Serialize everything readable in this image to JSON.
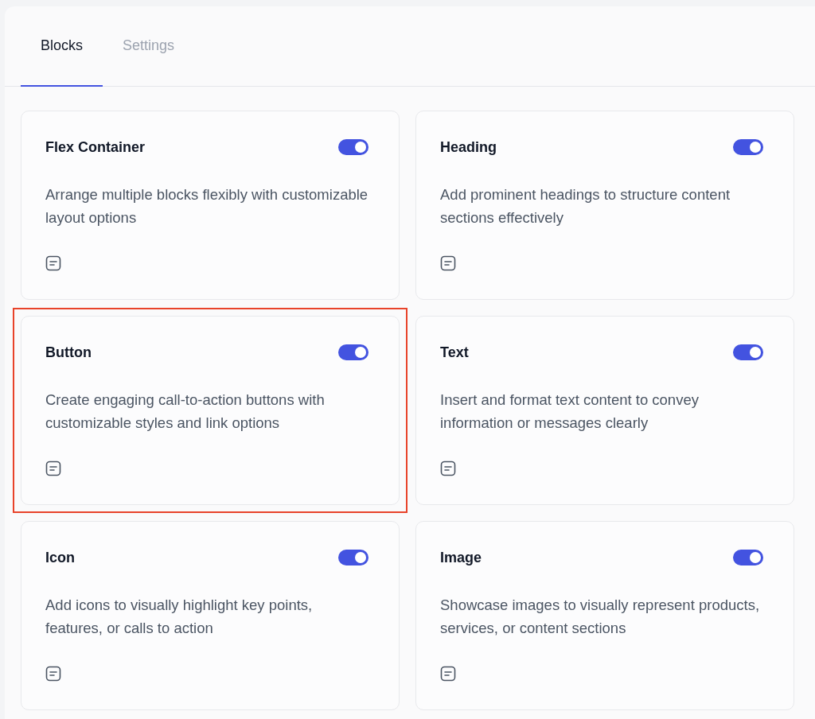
{
  "tabs": [
    {
      "label": "Blocks",
      "selected": true
    },
    {
      "label": "Settings",
      "selected": false
    }
  ],
  "blocks": [
    {
      "title": "Flex Container",
      "description": "Arrange multiple blocks flexibly with customizable layout options",
      "on": true,
      "highlighted": false
    },
    {
      "title": "Heading",
      "description": "Add prominent headings to structure content sections effectively",
      "on": true,
      "highlighted": false
    },
    {
      "title": "Button",
      "description": "Create engaging call-to-action buttons with customizable styles and link options",
      "on": true,
      "highlighted": true
    },
    {
      "title": "Text",
      "description": "Insert and format text content to convey information or messages clearly",
      "on": true,
      "highlighted": false
    },
    {
      "title": "Icon",
      "description": "Add icons to visually highlight key points, features, or calls to action",
      "on": true,
      "highlighted": false
    },
    {
      "title": "Image",
      "description": "Showcase images to visually represent products, services, or content sections",
      "on": true,
      "highlighted": false
    }
  ]
}
